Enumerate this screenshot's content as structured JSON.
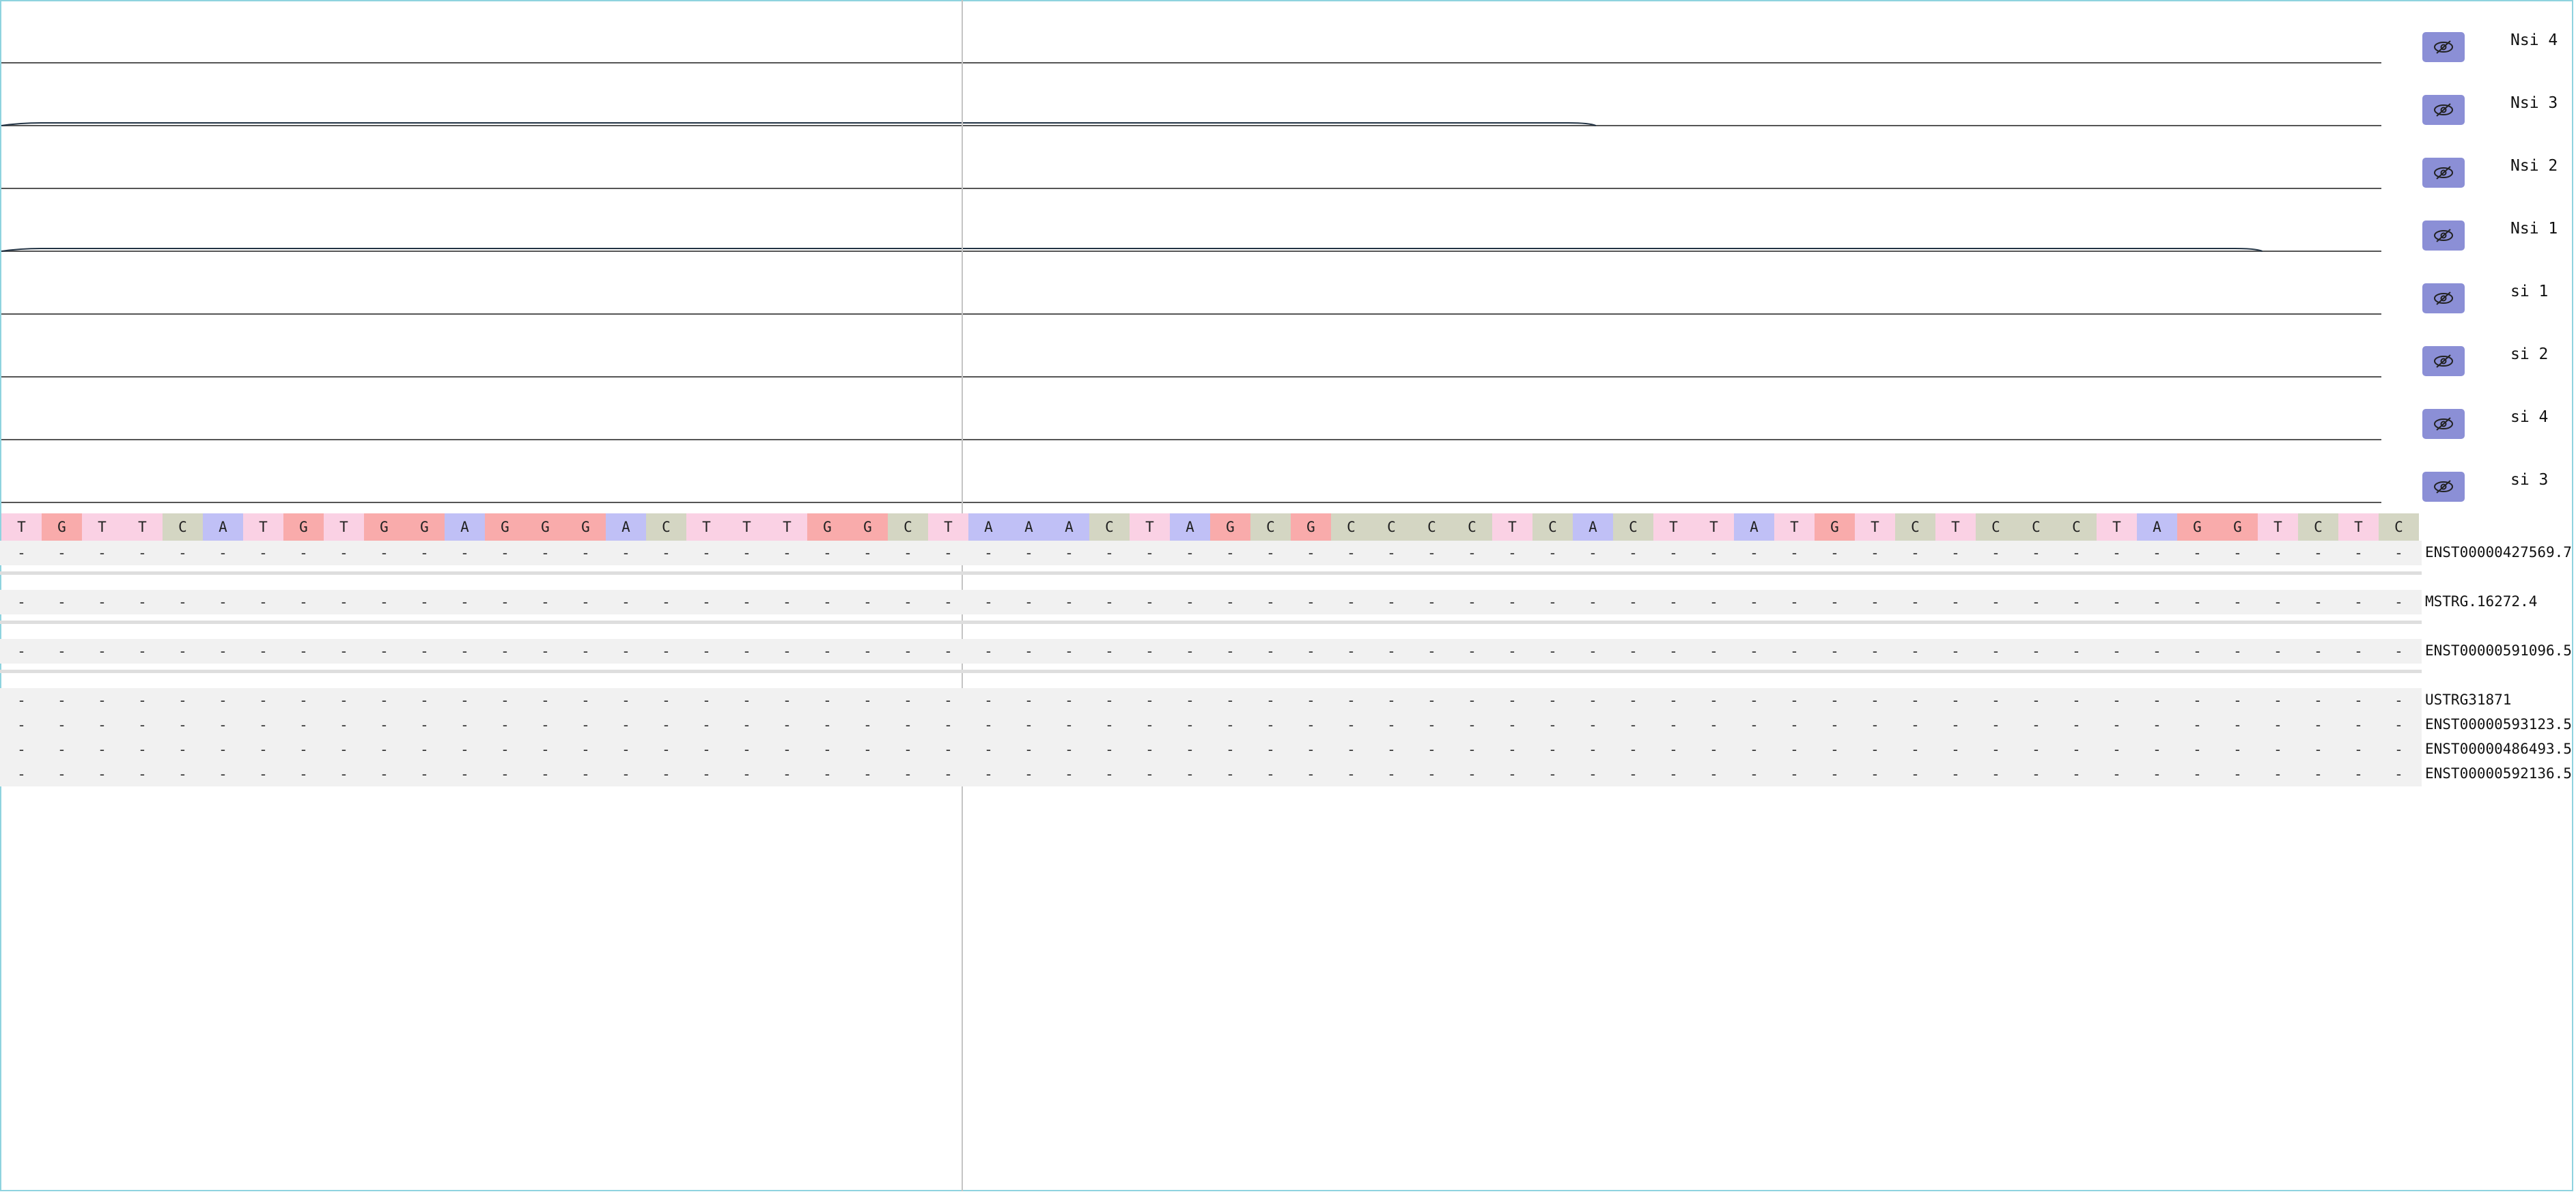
{
  "colors": {
    "A": "#c0c0f6",
    "C": "#d4d6c3",
    "G": "#f9abab",
    "T": "#fad1e4",
    "button": "#8b8fd6",
    "frame": "#8fd3df",
    "row_bg": "#f1f1f1"
  },
  "tracks": [
    {
      "label": "Nsi 4",
      "icon": "eye-slash-icon",
      "hidden": true,
      "signal_to_fraction": 0.0
    },
    {
      "label": "Nsi 3",
      "icon": "eye-slash-icon",
      "hidden": true,
      "signal_to_fraction": 0.67
    },
    {
      "label": "Nsi 2",
      "icon": "eye-slash-icon",
      "hidden": true,
      "signal_to_fraction": 0.0
    },
    {
      "label": "Nsi 1",
      "icon": "eye-slash-icon",
      "hidden": true,
      "signal_to_fraction": 0.95
    },
    {
      "label": "si 1",
      "icon": "eye-slash-icon",
      "hidden": true,
      "signal_to_fraction": 0.0
    },
    {
      "label": "si 2",
      "icon": "eye-slash-icon",
      "hidden": true,
      "signal_to_fraction": 0.0
    },
    {
      "label": "si 4",
      "icon": "eye-slash-icon",
      "hidden": true,
      "signal_to_fraction": 0.0
    },
    {
      "label": "si 3",
      "icon": "eye-slash-icon",
      "hidden": true,
      "signal_to_fraction": 0.0
    }
  ],
  "sequence": [
    "T",
    "G",
    "T",
    "T",
    "C",
    "A",
    "T",
    "G",
    "T",
    "G",
    "G",
    "A",
    "G",
    "G",
    "G",
    "A",
    "C",
    "T",
    "T",
    "T",
    "G",
    "G",
    "C",
    "T",
    "A",
    "A",
    "A",
    "C",
    "T",
    "A",
    "G",
    "C",
    "G",
    "C",
    "C",
    "C",
    "C",
    "T",
    "C",
    "A",
    "C",
    "T",
    "T",
    "A",
    "T",
    "G",
    "T",
    "C",
    "T",
    "C",
    "C",
    "C",
    "T",
    "A",
    "G",
    "G",
    "T",
    "C",
    "T",
    "C"
  ],
  "gap_char": "-",
  "transcript_groups": [
    [
      "ENST00000427569.7"
    ],
    [
      "MSTRG.16272.4"
    ],
    [
      "ENST00000591096.5"
    ],
    [
      "USTRG31871",
      "ENST00000593123.5",
      "ENST00000486493.5",
      "ENST00000592136.5"
    ]
  ]
}
